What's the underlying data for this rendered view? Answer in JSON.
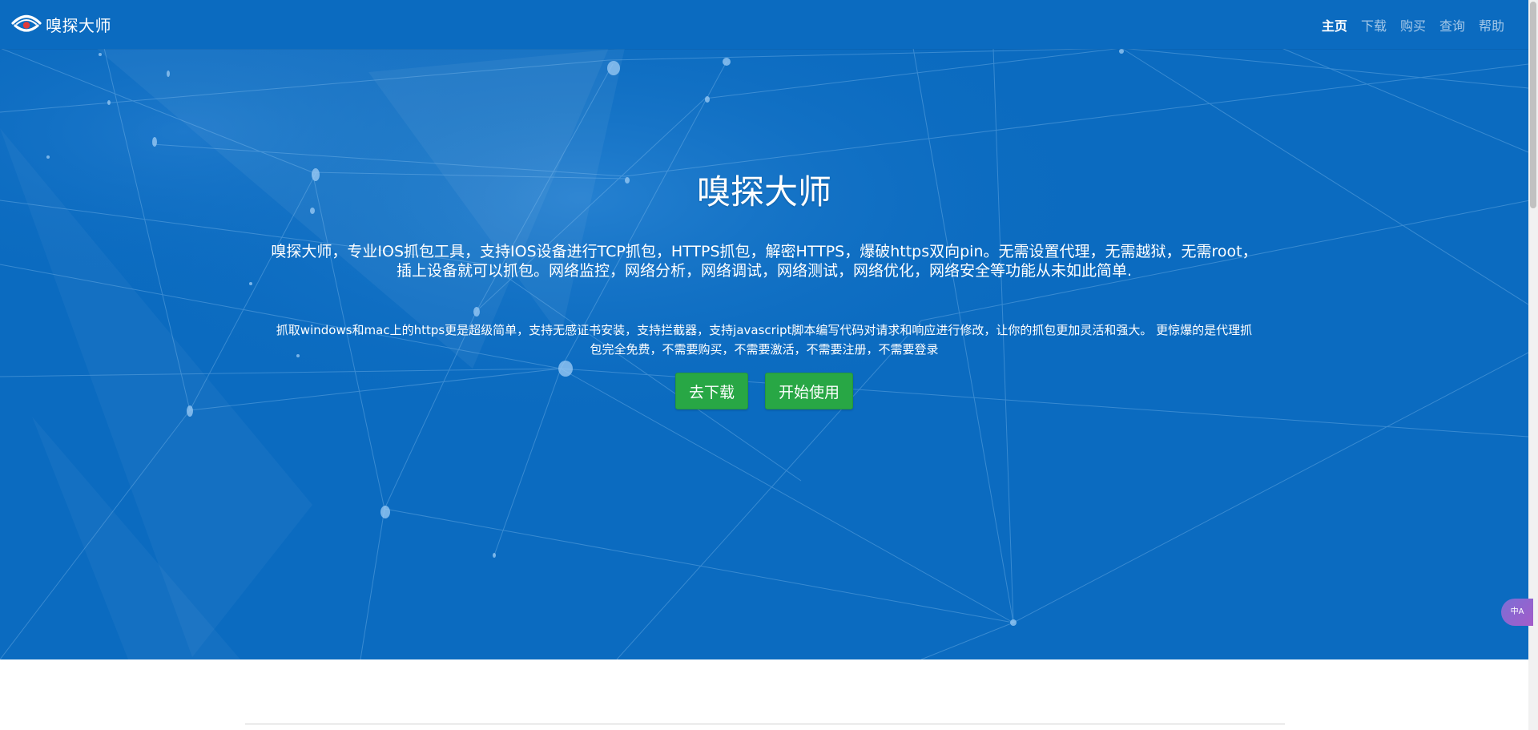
{
  "brand": {
    "name": "嗅探大师",
    "logo_icon": "eye-logo-icon"
  },
  "nav": {
    "items": [
      {
        "label": "主页",
        "active": true
      },
      {
        "label": "下载",
        "active": false
      },
      {
        "label": "购买",
        "active": false
      },
      {
        "label": "查询",
        "active": false
      },
      {
        "label": "帮助",
        "active": false
      }
    ]
  },
  "hero": {
    "title": "嗅探大师",
    "lead_line1": "嗅探大师，专业IOS抓包工具，支持IOS设备进行TCP抓包，HTTPS抓包，解密HTTPS，爆破https双向pin。无需设置代理，无需越狱，无需root，",
    "lead_line2": "插上设备就可以抓包。网络监控，网络分析，网络调试，网络测试，网络优化，网络安全等功能从未如此简单.",
    "sub_line1": "抓取windows和mac上的https更是超级简单，支持无感证书安装，支持拦截器，支持javascript脚本编写代码对请求和响应进行修改，让你的抓包更加灵活和强大。 更惊爆的是代理抓",
    "sub_line2": "包完全免费，不需要购买，不需要激活，不需要注册，不需要登录",
    "buttons": {
      "download_label": "去下载",
      "start_label": "开始使用"
    }
  },
  "translate_widget": {
    "label": "中A",
    "icon": "translate-icon"
  },
  "colors": {
    "hero_bg": "#0b6bc0",
    "button_green": "#28a745",
    "nav_active": "#ffffff",
    "nav_inactive": "rgba(255,255,255,0.62)"
  }
}
